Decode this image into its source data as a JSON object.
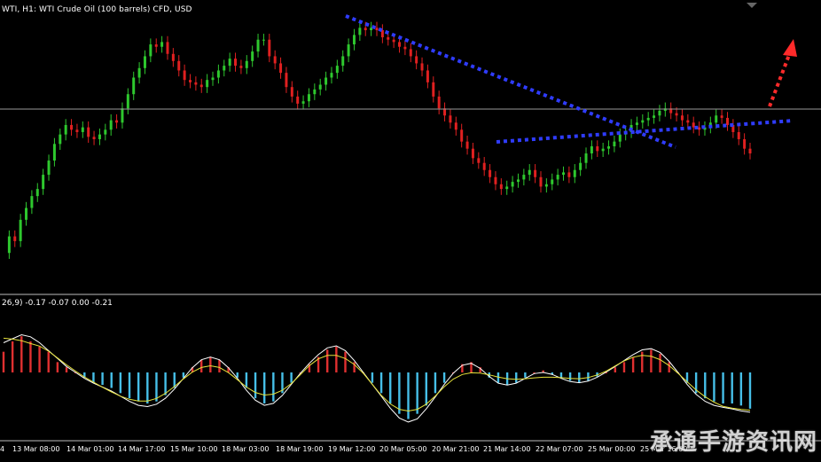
{
  "chart_data": {
    "type": "candlestick",
    "title": "WTI, H1:  WTI Crude Oil (100 barrels) CFD, USD",
    "indicator_label": "26,9) -0.17 -0.07 0.00 -0.21",
    "x_tick_labels": [
      "4",
      "13 Mar 08:00",
      "14 Mar 01:00",
      "14 Mar 17:00",
      "15 Mar 10:00",
      "18 Mar 03:00",
      "18 Mar 19:00",
      "19 Mar 12:00",
      "20 Mar 05:00",
      "20 Mar 21:00",
      "21 Mar 14:00",
      "22 Mar 07:00",
      "25 Mar 00:00",
      "25 Mar 16:00"
    ],
    "price_series": [
      -2.0,
      -1.3,
      -1.5,
      -0.6,
      -0.1,
      0.4,
      0.7,
      1.3,
      1.9,
      2.6,
      3.0,
      3.4,
      3.2,
      3.1,
      3.3,
      2.9,
      2.8,
      3.0,
      3.2,
      3.6,
      3.5,
      4.1,
      4.7,
      5.4,
      5.8,
      6.3,
      6.8,
      6.7,
      6.9,
      6.4,
      6.1,
      5.7,
      5.3,
      5.2,
      5.1,
      5.0,
      5.3,
      5.4,
      5.7,
      5.9,
      6.2,
      5.9,
      5.8,
      6.1,
      6.5,
      7.0,
      7.0,
      6.3,
      6.0,
      5.6,
      5.0,
      4.6,
      4.3,
      4.4,
      4.7,
      4.9,
      5.1,
      5.4,
      5.6,
      5.9,
      6.3,
      6.8,
      7.2,
      7.5,
      7.4,
      7.5,
      7.4,
      7.1,
      7.0,
      6.9,
      6.7,
      6.6,
      6.3,
      6.0,
      5.7,
      5.2,
      4.6,
      4.1,
      3.8,
      3.5,
      3.2,
      2.7,
      2.4,
      2.0,
      1.8,
      1.5,
      1.2,
      0.9,
      0.7,
      0.8,
      1.0,
      1.1,
      1.3,
      1.5,
      1.2,
      0.8,
      0.9,
      1.1,
      1.3,
      1.4,
      1.2,
      1.5,
      1.8,
      2.2,
      2.5,
      2.3,
      2.4,
      2.5,
      2.7,
      3.0,
      3.1,
      3.4,
      3.5,
      3.6,
      3.7,
      3.8,
      4.0,
      4.1,
      3.9,
      3.8,
      3.6,
      3.5,
      3.3,
      3.2,
      3.3,
      3.5,
      3.8,
      3.7,
      3.4,
      3.1,
      2.8,
      2.4,
      2.2
    ],
    "price_ylim": [
      -3,
      8
    ],
    "macd_histogram": [
      0.2,
      0.3,
      0.35,
      0.3,
      0.25,
      0.2,
      0.1,
      0.05,
      0.0,
      -0.05,
      -0.1,
      -0.12,
      -0.15,
      -0.2,
      -0.25,
      -0.28,
      -0.3,
      -0.28,
      -0.22,
      -0.15,
      -0.05,
      0.05,
      0.12,
      0.15,
      0.12,
      0.05,
      -0.05,
      -0.15,
      -0.25,
      -0.3,
      -0.28,
      -0.2,
      -0.1,
      0.0,
      0.08,
      0.15,
      0.22,
      0.25,
      0.2,
      0.1,
      0.0,
      -0.1,
      -0.2,
      -0.3,
      -0.4,
      -0.45,
      -0.4,
      -0.32,
      -0.2,
      -0.1,
      0.0,
      0.08,
      0.1,
      0.05,
      -0.05,
      -0.1,
      -0.12,
      -0.1,
      -0.05,
      0.0,
      0.02,
      -0.02,
      -0.05,
      -0.08,
      -0.1,
      -0.08,
      -0.04,
      0.0,
      0.05,
      0.1,
      0.15,
      0.2,
      0.22,
      0.18,
      0.1,
      0.0,
      -0.1,
      -0.2,
      -0.25,
      -0.28,
      -0.3,
      -0.3,
      -0.32,
      -0.35
    ],
    "macd_ylim": [
      -0.6,
      0.6
    ],
    "grid": false
  },
  "watermark": "承通手游资讯网"
}
